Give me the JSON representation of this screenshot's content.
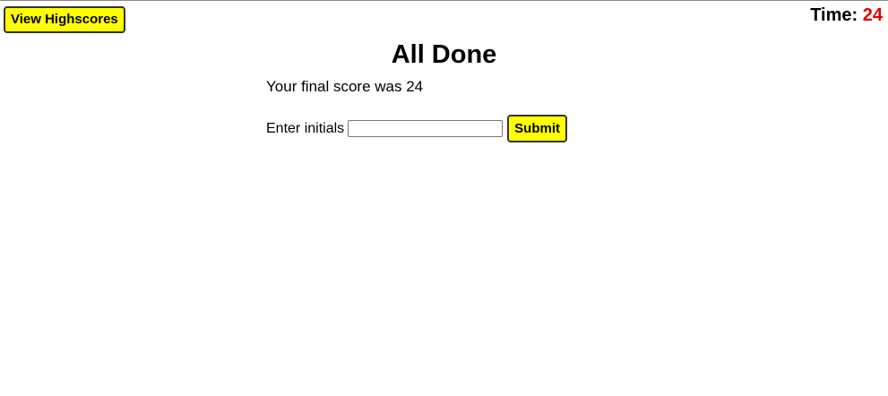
{
  "header": {
    "highscores_label": "View Highscores",
    "timer_label": "Time:",
    "timer_value": "24"
  },
  "main": {
    "title": "All Done",
    "final_score_text": "Your final score was 24",
    "initials_label": "Enter initials",
    "initials_value": "",
    "submit_label": "Submit"
  },
  "colors": {
    "button_bg": "#ffff00",
    "timer_value": "#e00000"
  }
}
